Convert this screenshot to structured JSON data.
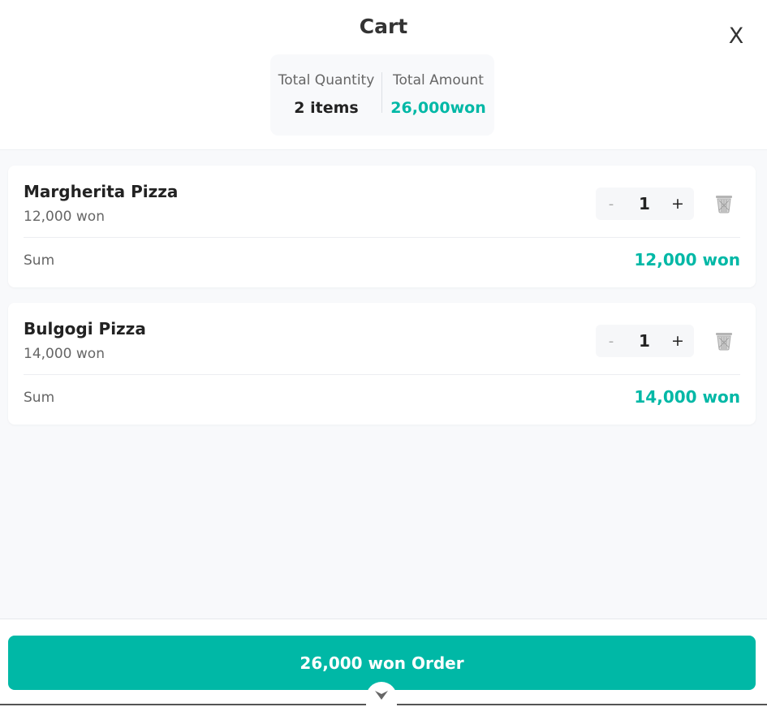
{
  "header": {
    "title": "Cart",
    "close_label": "X"
  },
  "summary": {
    "quantity_label": "Total Quantity",
    "quantity_value": "2 items",
    "amount_label": "Total Amount",
    "amount_value": "26,000won"
  },
  "items": [
    {
      "name": "Margherita Pizza",
      "price": "12,000 won",
      "quantity": "1",
      "minus_label": "-",
      "plus_label": "+",
      "sum_label": "Sum",
      "sum_value": "12,000 won"
    },
    {
      "name": "Bulgogi Pizza",
      "price": "14,000 won",
      "quantity": "1",
      "minus_label": "-",
      "plus_label": "+",
      "sum_label": "Sum",
      "sum_value": "14,000 won"
    }
  ],
  "footer": {
    "order_label": "26,000 won Order"
  },
  "icons": {
    "delete": "trash-icon",
    "collapse": "chevron-down-icon"
  },
  "colors": {
    "accent": "#00b8a6",
    "background": "#f8f9fb"
  }
}
